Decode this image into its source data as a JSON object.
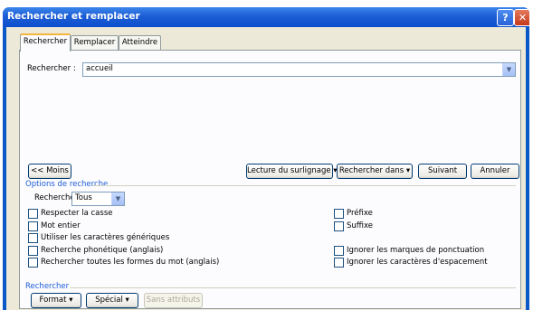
{
  "window": {
    "title": "Rechercher et remplacer",
    "help_label": "?",
    "close_label": "✕"
  },
  "tabs": [
    {
      "label": "Rechercher",
      "active": true
    },
    {
      "label": "Remplacer",
      "active": false
    },
    {
      "label": "Atteindre",
      "active": false
    }
  ],
  "search": {
    "label": "Rechercher :",
    "value": "accueil"
  },
  "buttons": {
    "less": "<< Moins",
    "reading_highlight": "Lecture du surlignage",
    "find_in": "Rechercher dans",
    "next": "Suivant",
    "cancel": "Annuler",
    "format": "Format",
    "special": "Spécial",
    "no_formatting": "Sans attributs"
  },
  "options": {
    "section_title": "Options de recherche",
    "direction_label": "Rechercher :",
    "direction_value": "Tous",
    "left": [
      {
        "label": "Respecter la casse",
        "checked": false
      },
      {
        "label": "Mot entier",
        "checked": false
      },
      {
        "label": "Utiliser les caractères génériques",
        "checked": false
      },
      {
        "label": "Recherche phonétique (anglais)",
        "checked": false
      },
      {
        "label": "Rechercher toutes les formes du mot (anglais)",
        "checked": false
      }
    ],
    "right": [
      {
        "label": "Préfixe",
        "checked": false
      },
      {
        "label": "Suffixe",
        "checked": false
      },
      {
        "label": "Ignorer les marques de ponctuation",
        "checked": false
      },
      {
        "label": "Ignorer les caractères d'espacement",
        "checked": false
      }
    ]
  },
  "bottom_section": {
    "title": "Rechercher"
  },
  "colors": {
    "titlebar": "#0c4fcb",
    "dialog_bg": "#ece9d8",
    "section_label": "#1d5bd6",
    "active_tab_accent": "#f4b53f"
  }
}
